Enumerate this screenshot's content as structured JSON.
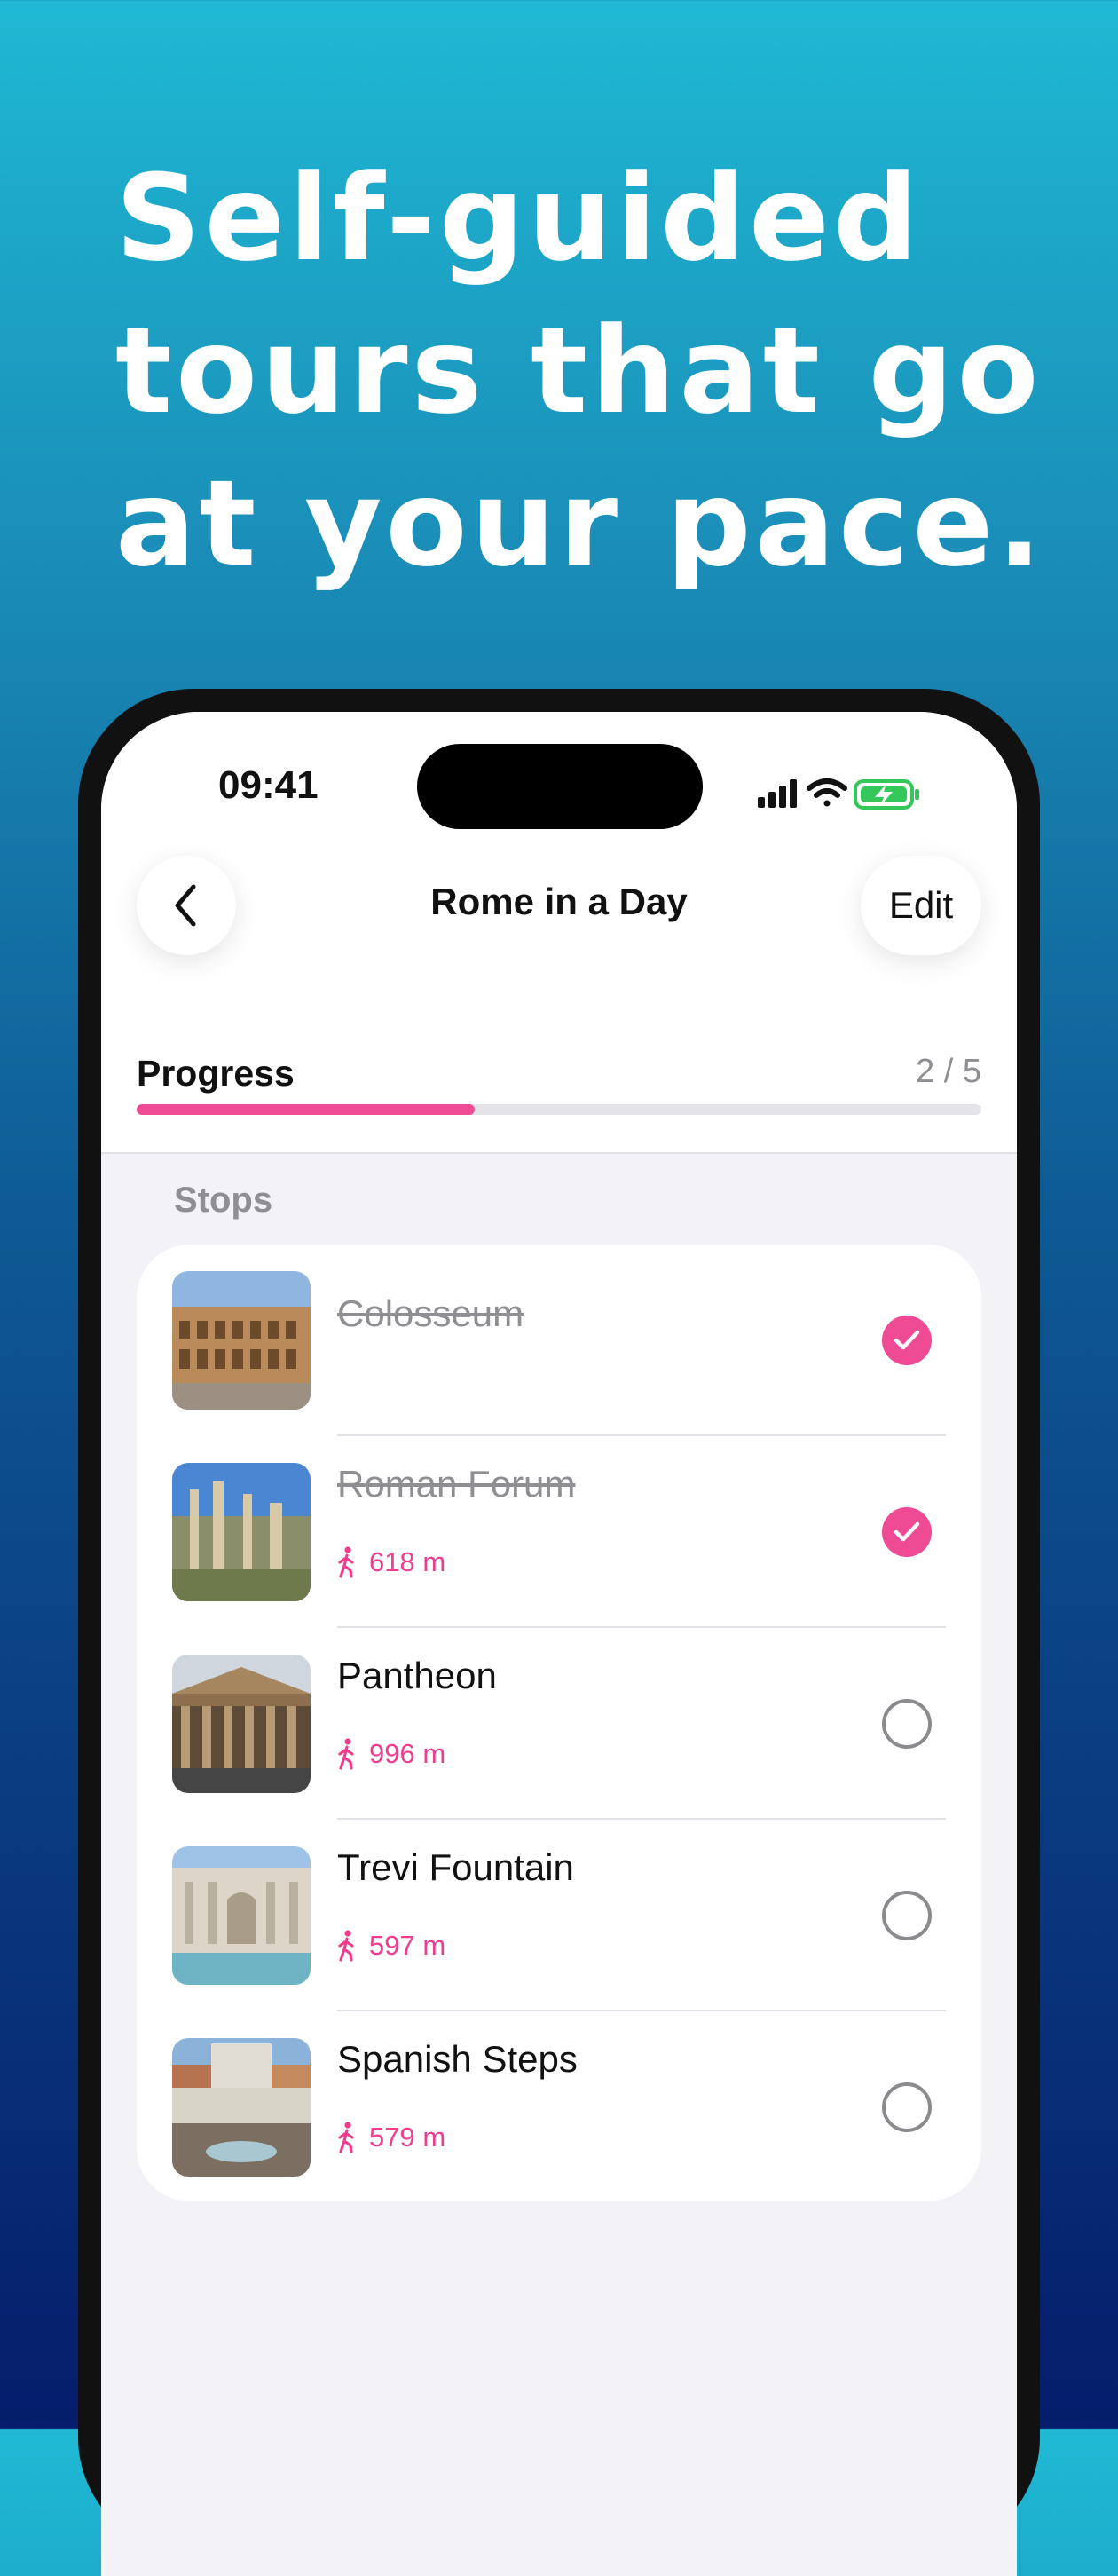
{
  "headline": [
    "Self-guided",
    "tours that go",
    "at your pace."
  ],
  "status_bar": {
    "time": "09:41"
  },
  "nav": {
    "title": "Rome in a Day",
    "edit_label": "Edit"
  },
  "progress": {
    "label": "Progress",
    "count": "2 / 5",
    "fraction": 0.4
  },
  "stops_label": "Stops",
  "stops": [
    {
      "name": "Colosseum",
      "distance": "",
      "done": true
    },
    {
      "name": "Roman Forum",
      "distance": "618 m",
      "done": true
    },
    {
      "name": "Pantheon",
      "distance": "996 m",
      "done": false
    },
    {
      "name": "Trevi Fountain",
      "distance": "597 m",
      "done": false
    },
    {
      "name": "Spanish Steps",
      "distance": "579 m",
      "done": false
    }
  ],
  "colors": {
    "accent": "#ef4a94",
    "background_top": "#1fb9d4",
    "background_bottom": "#051d6c"
  }
}
